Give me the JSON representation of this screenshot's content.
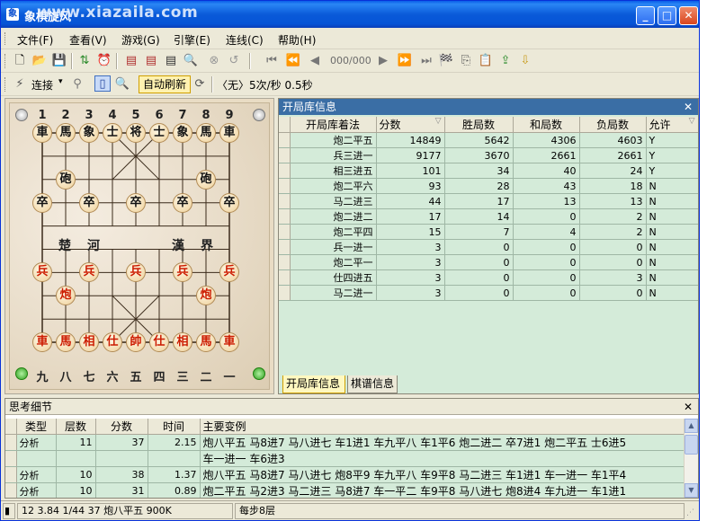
{
  "window": {
    "title": "象棋旋风",
    "watermark": "www.xiazaila.com"
  },
  "menu": [
    "文件(F)",
    "查看(V)",
    "游戏(G)",
    "引擎(E)",
    "连线(C)",
    "帮助(H)"
  ],
  "toolbar1": {
    "counter": "000/000"
  },
  "toolbar2": {
    "connect_label": "连接",
    "auto_refresh_label": "自动刷新",
    "speed_text": "〈无〉5次/秒 0.5秒"
  },
  "board": {
    "top_coords": [
      "1",
      "2",
      "3",
      "4",
      "5",
      "6",
      "7",
      "8",
      "9"
    ],
    "bottom_coords": [
      "九",
      "八",
      "七",
      "六",
      "五",
      "四",
      "三",
      "二",
      "一"
    ],
    "river_left": "楚　河",
    "river_right": "漢　界",
    "black_back_row": [
      "車",
      "馬",
      "象",
      "士",
      "将",
      "士",
      "象",
      "馬",
      "車"
    ],
    "black_cannons": [
      "砲",
      "砲"
    ],
    "black_pawns": [
      "卒",
      "卒",
      "卒",
      "卒",
      "卒"
    ],
    "red_pawns": [
      "兵",
      "兵",
      "兵",
      "兵",
      "兵"
    ],
    "red_cannons": [
      "炮",
      "炮"
    ],
    "red_back_row": [
      "車",
      "馬",
      "相",
      "仕",
      "帥",
      "仕",
      "相",
      "馬",
      "車"
    ]
  },
  "opening_panel": {
    "title": "开局库信息",
    "columns": [
      "开局库着法",
      "分数",
      "胜局数",
      "和局数",
      "负局数",
      "允许"
    ],
    "rows": [
      [
        "炮二平五",
        "14849",
        "5642",
        "4306",
        "4603",
        "Y"
      ],
      [
        "兵三进一",
        "9177",
        "3670",
        "2661",
        "2661",
        "Y"
      ],
      [
        "相三进五",
        "101",
        "34",
        "40",
        "24",
        "Y"
      ],
      [
        "炮二平六",
        "93",
        "28",
        "43",
        "18",
        "N"
      ],
      [
        "马二进三",
        "44",
        "17",
        "13",
        "13",
        "N"
      ],
      [
        "炮二进二",
        "17",
        "14",
        "0",
        "2",
        "N"
      ],
      [
        "炮二平四",
        "15",
        "7",
        "4",
        "2",
        "N"
      ],
      [
        "兵一进一",
        "3",
        "0",
        "0",
        "0",
        "N"
      ],
      [
        "炮二平一",
        "3",
        "0",
        "0",
        "0",
        "N"
      ],
      [
        "仕四进五",
        "3",
        "0",
        "0",
        "3",
        "N"
      ],
      [
        "马二进一",
        "3",
        "0",
        "0",
        "0",
        "N"
      ]
    ],
    "tabs": [
      "开局库信息",
      "棋谱信息"
    ]
  },
  "thinking_panel": {
    "title": "思考细节",
    "columns": [
      "类型",
      "层数",
      "分数",
      "时间",
      "主要变例"
    ],
    "rows": [
      [
        "分析",
        "11",
        "37",
        "2.15",
        "炮八平五 马8进7 马八进七 车1进1 车九平八 车1平6 炮二进二 卒7进1 炮二平五 士6进5"
      ],
      [
        "",
        "",
        "",
        "",
        "车一进一 车6进3"
      ],
      [
        "分析",
        "10",
        "38",
        "1.37",
        "炮八平五 马8进7 马八进七 炮8平9 车九平八 车9平8 马二进三 车1进1 车一进一 车1平4"
      ],
      [
        "分析",
        "10",
        "31",
        "0.89",
        "炮二平五 马2进3 马二进三 马8进7 车一平二 车9平8 马八进七 炮8进4 车九进一 车1进1"
      ]
    ]
  },
  "status": {
    "left": "12 3.84 1/44 37 炮八平五 900K",
    "right": "每步8层"
  }
}
